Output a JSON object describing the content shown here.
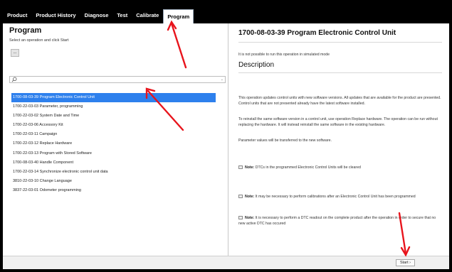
{
  "menu": {
    "tabs": [
      {
        "label": "Product"
      },
      {
        "label": "Product History"
      },
      {
        "label": "Diagnose"
      },
      {
        "label": "Test"
      },
      {
        "label": "Calibrate"
      },
      {
        "label": "Program",
        "active": true
      }
    ]
  },
  "left": {
    "title": "Program",
    "subtitle": "Select an operation and click Start",
    "ellipsis_label": "...",
    "search": {
      "placeholder": ""
    },
    "operations": [
      {
        "label": "1700-08-03-39 Program Electronic Control Unit",
        "selected": true
      },
      {
        "label": "1700-22-03-03 Parameter, programming"
      },
      {
        "label": "1700-22-03-02 System Date and Time"
      },
      {
        "label": "1700-22-03-06 Accessory Kit"
      },
      {
        "label": "1700-22-03-11 Campaign"
      },
      {
        "label": "1700-22-03-12 Replace Hardware"
      },
      {
        "label": "1700-22-03-13 Program with Stored Software"
      },
      {
        "label": "1700-08-03-40 Handle Component"
      },
      {
        "label": "1700-22-03-14 Synchronize electronic control unit data"
      },
      {
        "label": "3810-22-03-10 Change Language"
      },
      {
        "label": "3837-22-03-01 Odometer programming"
      }
    ]
  },
  "right": {
    "title": "1700-08-03-39 Program Electronic Control Unit",
    "simulated_notice": "It is not possible to run this operation in simulated mode",
    "description_heading": "Description",
    "paragraphs": [
      "This operation updates control units with new software versions. All updates that are available for the product are presented. Control units that are not presented already have the latest software installed.",
      "To reinstall the same software version in a control unit, use operation Replace hardware. The operation can be run without replacing the hardware. It will instead reinstall the same software in the existing hardware.",
      "Parameter values will be transferred to the new software."
    ],
    "note_label": "Note:",
    "notes": [
      "DTCs in the programmed Electronic Control Units will be cleared",
      "It may be necessary to perform calibrations after an Electronic Control Unit has been programmed",
      "It is necessary to perform a DTC readout on the complete product after the operation in order to secure that no new active DTC has occured"
    ]
  },
  "footer": {
    "start_label": "Start ›"
  },
  "colors": {
    "selection": "#2e80ed",
    "annotation_arrow": "#e8141c"
  }
}
